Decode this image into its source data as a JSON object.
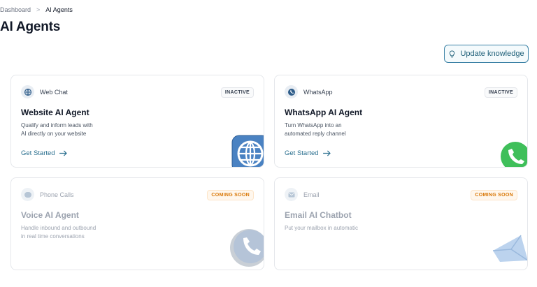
{
  "breadcrumb": {
    "root": "Dashboard",
    "separator": ">",
    "current": "AI Agents"
  },
  "page": {
    "title": "AI Agents"
  },
  "actions": {
    "update_knowledge": "Update knowledge",
    "update_icon": "lightbulb-icon"
  },
  "cards": [
    {
      "channel": "Web Chat",
      "icon": "globe-icon",
      "status": "INACTIVE",
      "title": "Website AI Agent",
      "desc1": "Qualify and inform leads with",
      "desc2": "AI directly on your website",
      "cta": "Get Started"
    },
    {
      "channel": "WhatsApp",
      "icon": "whatsapp-icon",
      "status": "INACTIVE",
      "title": "WhatsApp AI Agent",
      "desc1": "Turn WhatsApp into an",
      "desc2": "automated reply channel",
      "cta": "Get Started"
    },
    {
      "channel": "Phone Calls",
      "icon": "phone-icon",
      "status": "COMING SOON",
      "title": "Voice AI Agent",
      "desc1": "Handle inbound and outbound",
      "desc2": "in real time conversations"
    },
    {
      "channel": "Email",
      "icon": "email-icon",
      "status": "COMING SOON",
      "title": "Email AI Chatbot",
      "desc1": "Put your mailbox in automatic"
    }
  ],
  "colors": {
    "accent": "#2a6f8f",
    "border": "#e5e7eb",
    "soon": "#d97706"
  }
}
